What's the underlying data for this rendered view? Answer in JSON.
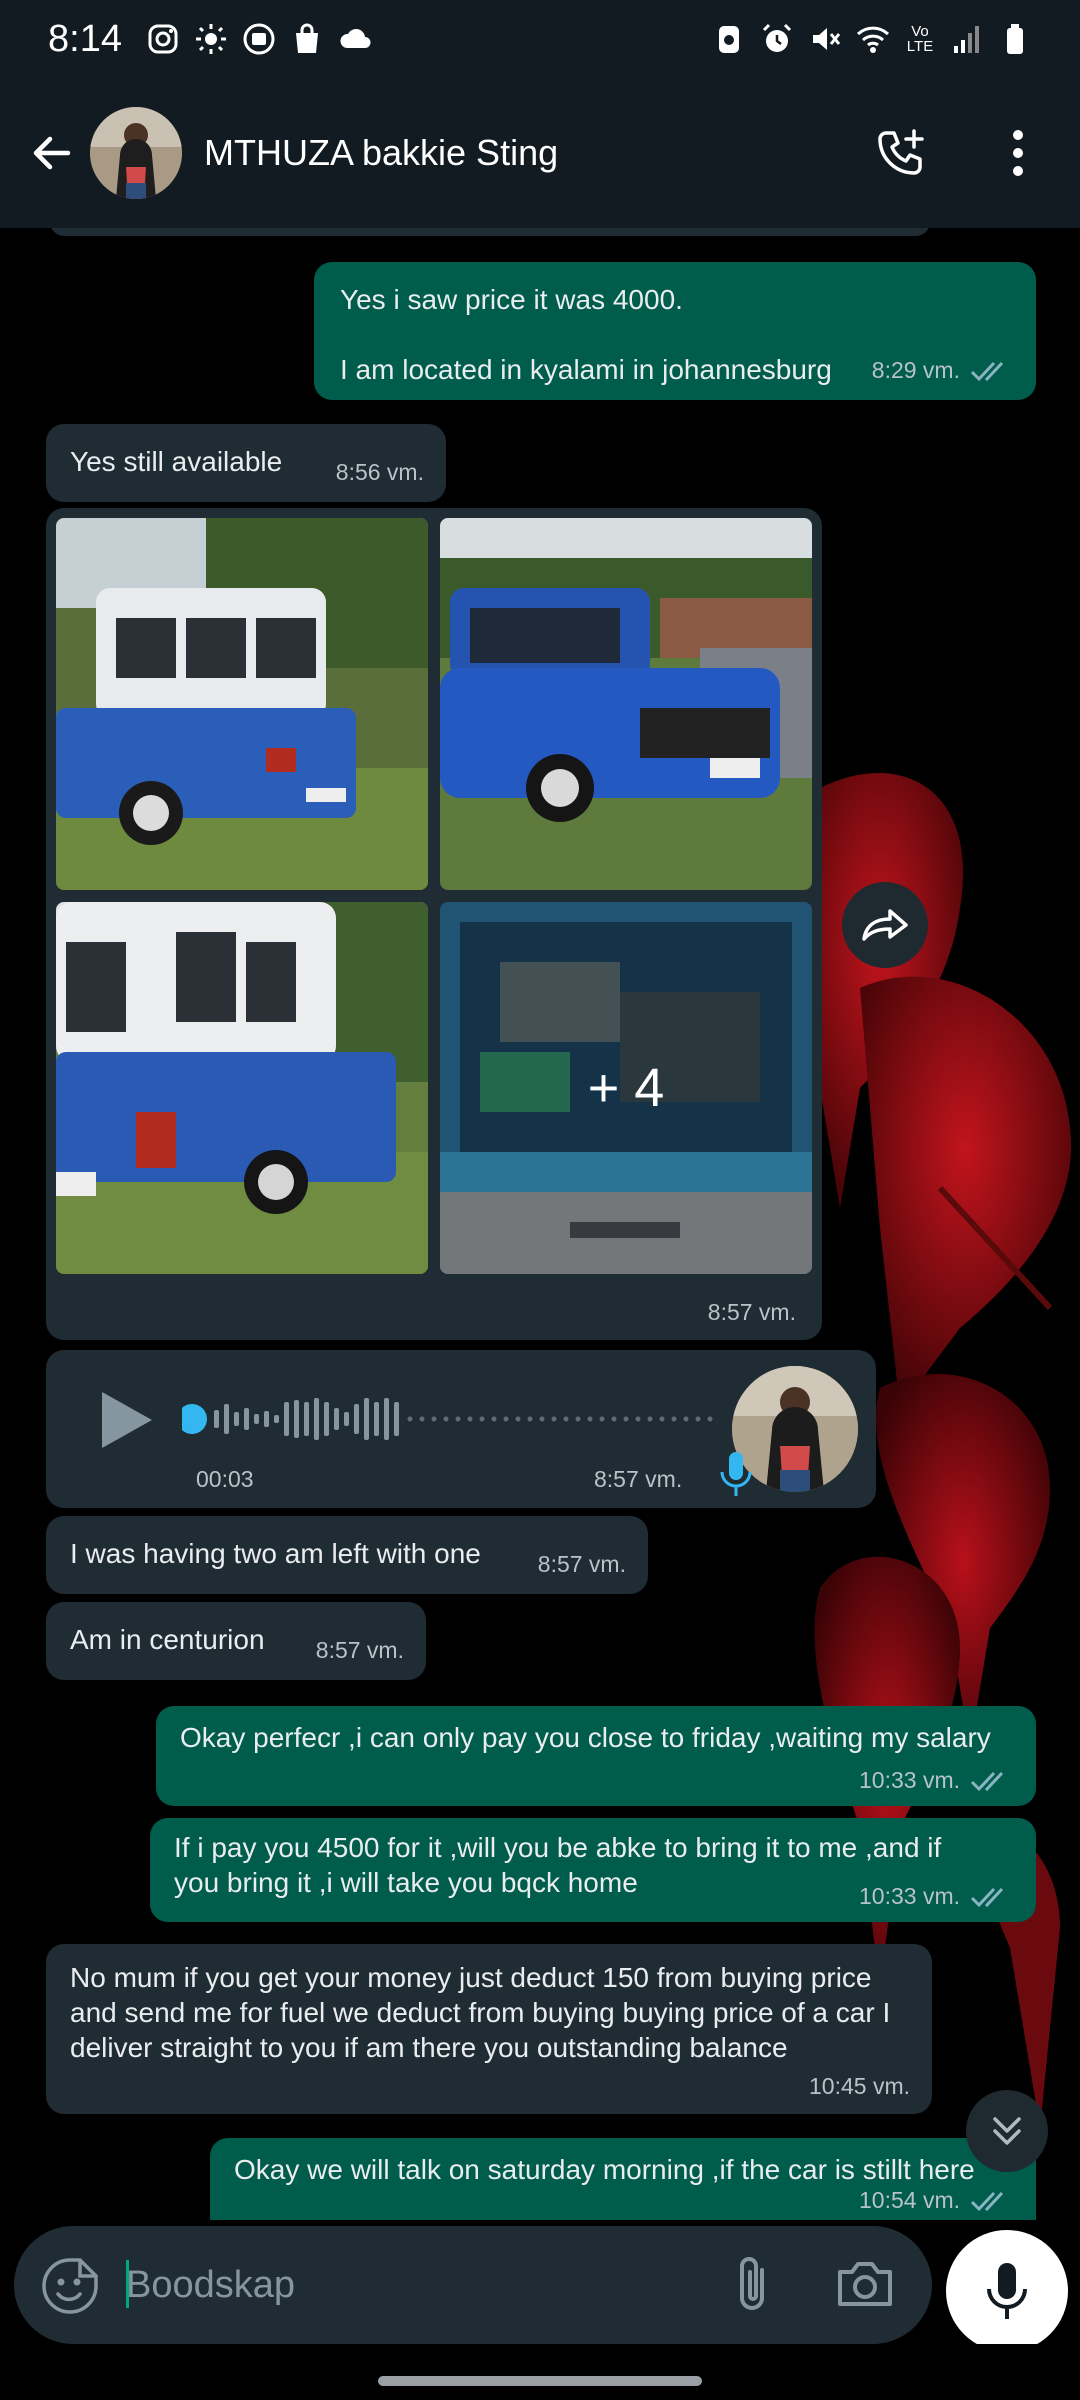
{
  "status_bar": {
    "time": "8:14",
    "network": "Vo LTE"
  },
  "header": {
    "contact_name": "MTHUZA bakkie Sting"
  },
  "messages": [
    {
      "id": "m1",
      "direction": "out",
      "lines": [
        "Yes i saw price it was 4000.",
        "",
        "I am located in kyalami in johannesburg"
      ],
      "time": "8:29 vm.",
      "read": true
    },
    {
      "id": "m2",
      "direction": "in",
      "text": "Yes still available",
      "time": "8:56 vm."
    },
    {
      "id": "m3",
      "direction": "in",
      "type": "album",
      "more_count": "+ 4",
      "time": "8:57 vm."
    },
    {
      "id": "m4",
      "direction": "in",
      "type": "voice",
      "duration": "00:03",
      "time": "8:57 vm."
    },
    {
      "id": "m5",
      "direction": "in",
      "text": "I was having two am left with one",
      "time": "8:57 vm."
    },
    {
      "id": "m6",
      "direction": "in",
      "text": "Am in centurion",
      "time": "8:57 vm."
    },
    {
      "id": "m7",
      "direction": "out",
      "text": "Okay perfecr ,i can only pay you close to friday ,waiting my salary",
      "time": "10:33 vm.",
      "read": true
    },
    {
      "id": "m8",
      "direction": "out",
      "lines": [
        "If i pay you 4500 for it ,will you be abke to bring it to me ,and if",
        "you bring it ,i will take you bqck home"
      ],
      "time": "10:33 vm.",
      "read": true
    },
    {
      "id": "m9",
      "direction": "in",
      "lines": [
        "No mum if you get your money just deduct 150 from buying price",
        "and send me for fuel we deduct from buying buying price of a car I",
        "deliver straight to you if am there you outstanding balance"
      ],
      "time": "10:45 vm."
    },
    {
      "id": "m10",
      "direction": "out",
      "text": "Okay we will talk on saturday morning ,if the car is stillt here",
      "time": "10:54 vm.",
      "read": true
    }
  ],
  "composer": {
    "placeholder": "Boodskap"
  },
  "colors": {
    "incoming_bubble": "#202c33",
    "outgoing_bubble": "#005c4b",
    "header_bg": "#121b22",
    "read_ticks": "#8ab4c4"
  },
  "icons": {
    "back": "arrow-left-icon",
    "call": "add-call-icon",
    "menu": "more-vert-icon",
    "forward": "forward-icon",
    "scroll": "double-chevron-down-icon",
    "emoji": "sticker-icon",
    "attach": "paperclip-icon",
    "camera": "camera-icon",
    "mic": "mic-icon"
  }
}
